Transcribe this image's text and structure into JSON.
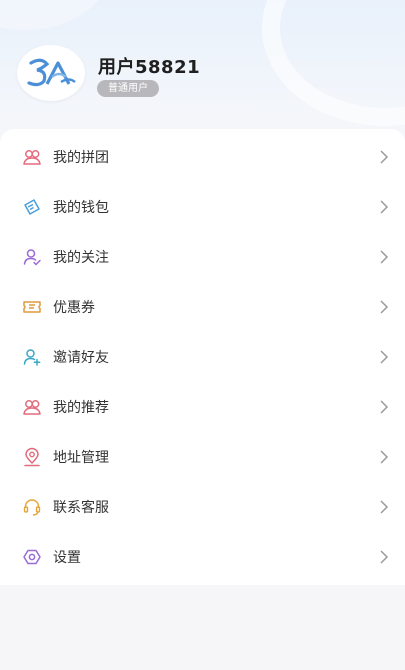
{
  "profile": {
    "username": "用户58821",
    "badge": "普通用户"
  },
  "menu": [
    {
      "label": "我的拼团",
      "icon": "group-icon",
      "color": "#e86a7d"
    },
    {
      "label": "我的钱包",
      "icon": "wallet-icon",
      "color": "#4a9fd8"
    },
    {
      "label": "我的关注",
      "icon": "follow-user-icon",
      "color": "#9b6ad8"
    },
    {
      "label": "优惠券",
      "icon": "coupon-icon",
      "color": "#e09a3c"
    },
    {
      "label": "邀请好友",
      "icon": "invite-user-icon",
      "color": "#3aa7c7"
    },
    {
      "label": "我的推荐",
      "icon": "recommend-users-icon",
      "color": "#e06c7c"
    },
    {
      "label": "地址管理",
      "icon": "location-icon",
      "color": "#e06c7c"
    },
    {
      "label": "联系客服",
      "icon": "headset-icon",
      "color": "#e8a33a"
    },
    {
      "label": "设置",
      "icon": "settings-icon",
      "color": "#9b6ad8"
    }
  ]
}
